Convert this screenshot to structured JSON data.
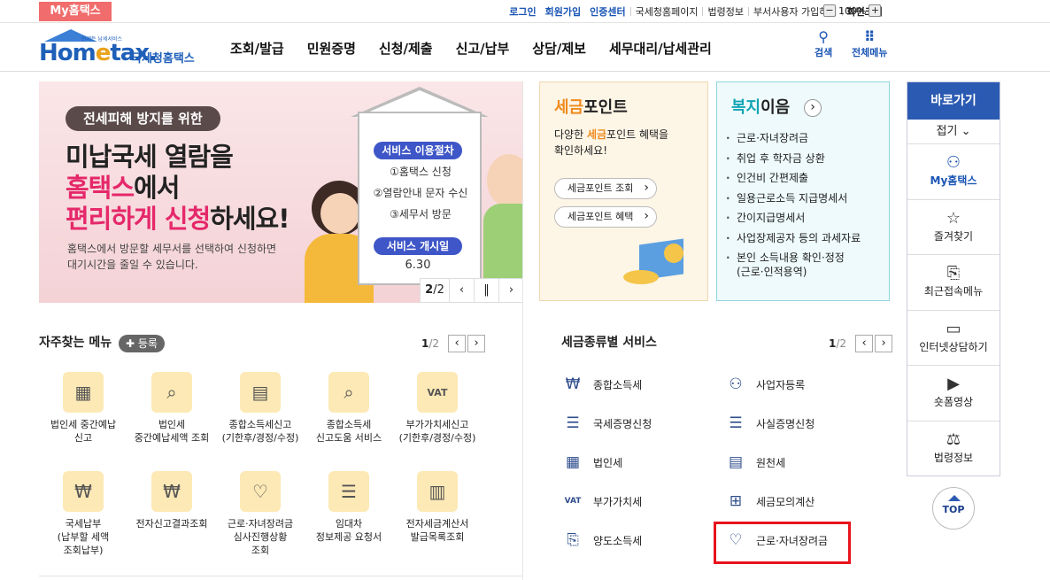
{
  "topbar": {
    "my_tab": "My홈택스",
    "links": [
      "로그인",
      "회원가입",
      "인증센터",
      "국세청홈페이지",
      "법령정보",
      "부서사용자 가입하기",
      "화면크기"
    ],
    "zoom_minus": "−",
    "zoom_level": "100%",
    "zoom_plus": "+"
  },
  "header": {
    "logo_small": "언제든 납세서비스",
    "logo_home_a": "Hom",
    "logo_home_e": "e",
    "logo_home_b": "tax.",
    "logo_kr": "국세청홈택스",
    "nav": [
      "조회/발급",
      "민원증명",
      "신청/제출",
      "신고/납부",
      "상담/제보",
      "세무대리/납세관리"
    ],
    "search_label": "검색",
    "allmenu_label": "전체메뉴",
    "search_icon": "magnifier-icon",
    "allmenu_icon": "grid-icon"
  },
  "banner": {
    "pill": "전세피해 방지를 위한",
    "line1": "미납국세 열람을",
    "line2_pink": "홈택스",
    "line2_rest": "에서",
    "line3_pink": "편리하게 신청",
    "line3_rest": "하세요!",
    "sub1": "홈택스에서 방문할 세무서를 선택하여 신청하면",
    "sub2": "대기시간을 줄일 수 있습니다.",
    "proc_title": "서비스 이용절차",
    "steps": [
      "①홈택스 신청",
      "②열람안내 문자 수신",
      "③세무서 방문"
    ],
    "start_title": "서비스 개시일",
    "start_date": "6.30",
    "page_current": "2",
    "page_total": "/2"
  },
  "tax_point": {
    "title_orange": "세금",
    "title_rest": "포인트",
    "desc_a": "다양한 ",
    "desc_orange": "세금",
    "desc_b": "포인트 혜택을",
    "desc_c": "확인하세요!",
    "btn1": "세금포인트 조회",
    "btn2": "세금포인트 혜택"
  },
  "welfare": {
    "title_teal": "복지",
    "title_rest": "이음",
    "items": [
      "근로·자녀장려금",
      "취업 후 학자금 상환",
      "인건비 간편제출",
      "일용근로소득 지급명세서",
      "간이지급명세서",
      "사업장제공자 등의 과세자료"
    ],
    "last_item_1": "본인 소득내용 확인·정정",
    "last_item_2": "(근로·인적용역)"
  },
  "quick": {
    "title": "바로가기",
    "fold": "접기 ⌄",
    "items": [
      {
        "label": "My홈택스",
        "icon": "person-icon"
      },
      {
        "label": "즐겨찾기",
        "icon": "star-icon"
      },
      {
        "label": "최근접속메뉴",
        "icon": "document-search-icon"
      },
      {
        "label": "인터넷상담하기",
        "icon": "laptop-icon"
      },
      {
        "label": "숏폼영상",
        "icon": "play-icon"
      },
      {
        "label": "법령정보",
        "icon": "gavel-icon"
      }
    ],
    "top": "TOP"
  },
  "frequent": {
    "title": "자주찾는 메뉴",
    "register": "✚ 등록",
    "page": "1",
    "total": "/2",
    "items": [
      {
        "l1": "법인세 중간예납",
        "l2": "신고",
        "l3": "",
        "icon": "building-icon"
      },
      {
        "l1": "법인세",
        "l2": "중간예납세액 조회",
        "l3": "",
        "icon": "search-doc-icon"
      },
      {
        "l1": "종합소득세신고",
        "l2": "(기한후/경정/수정)",
        "l3": "",
        "icon": "calendar-icon"
      },
      {
        "l1": "종합소득세",
        "l2": "신고도움 서비스",
        "l3": "",
        "icon": "search-doc-icon"
      },
      {
        "l1": "부가가치세신고",
        "l2": "(기한후/경정/수정)",
        "l3": "",
        "icon": "vat-icon"
      },
      {
        "l1": "국세납부",
        "l2": "(납부할 세액",
        "l3": "조회납부)",
        "icon": "money-bag-icon"
      },
      {
        "l1": "전자신고결과조회",
        "l2": "",
        "l3": "",
        "icon": "won-search-icon"
      },
      {
        "l1": "근로·자녀장려금",
        "l2": "심사진행상황",
        "l3": "조회",
        "icon": "heart-icon"
      },
      {
        "l1": "임대차",
        "l2": "정보제공 요청서",
        "l3": "",
        "icon": "document-icon"
      },
      {
        "l1": "전자세금계산서",
        "l2": "발급목록조회",
        "l3": "",
        "icon": "invoice-icon"
      }
    ]
  },
  "taxtype": {
    "title": "세금종류별 서비스",
    "page": "1",
    "total": "/2",
    "items": [
      {
        "label": "종합소득세",
        "icon": "money-hand-icon"
      },
      {
        "label": "사업자등록",
        "icon": "person-icon"
      },
      {
        "label": "국세증명신청",
        "icon": "document-icon"
      },
      {
        "label": "사실증명신청",
        "icon": "document-icon"
      },
      {
        "label": "법인세",
        "icon": "building-icon"
      },
      {
        "label": "원천세",
        "icon": "receipt-icon"
      },
      {
        "label": "부가가치세",
        "icon": "vat-icon"
      },
      {
        "label": "세금모의계산",
        "icon": "calculator-icon"
      },
      {
        "label": "양도소득세",
        "icon": "transfer-doc-icon"
      },
      {
        "label": "근로·자녀장려금",
        "icon": "heart-hand-icon"
      }
    ]
  }
}
